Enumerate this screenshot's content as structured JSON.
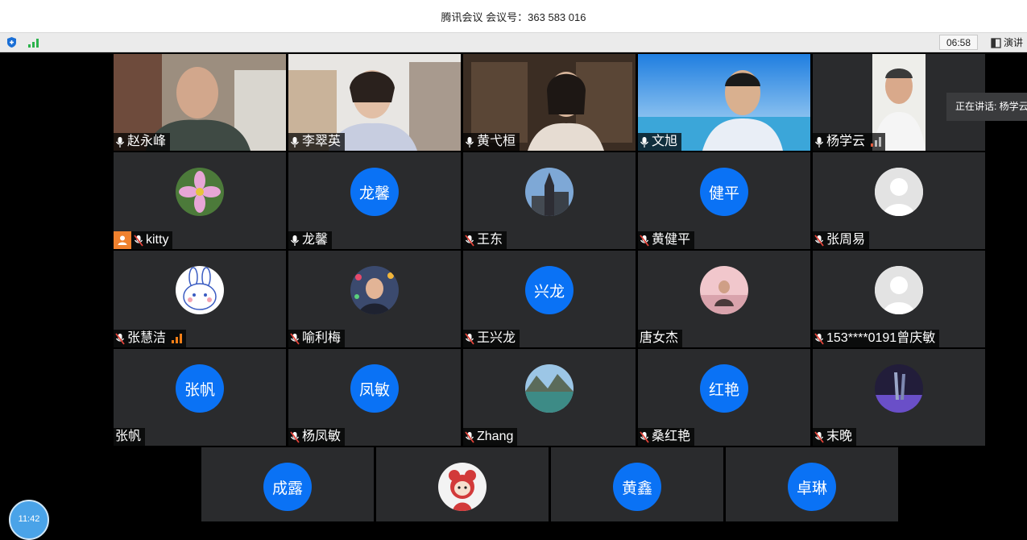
{
  "window": {
    "title": "腾讯会议 会议号：363 583 016"
  },
  "toolbar": {
    "timer": "06:58",
    "present_label": "演讲"
  },
  "speaking_tooltip": "正在讲话: 杨学云",
  "clock": {
    "time": "11:42"
  },
  "participants": [
    {
      "name": "赵永峰",
      "mic": "on",
      "video": true
    },
    {
      "name": "李翠英",
      "mic": "on",
      "video": true
    },
    {
      "name": "黄弋桓",
      "mic": "on",
      "video": true
    },
    {
      "name": "文旭",
      "mic": "on",
      "video": true
    },
    {
      "name": "杨学云",
      "mic": "on",
      "video": true,
      "speaking": true
    },
    {
      "name": "kitty",
      "mic": "muted",
      "avatar": "flower"
    },
    {
      "name": "龙馨",
      "mic": "on",
      "avatar_text": "龙馨"
    },
    {
      "name": "王东",
      "mic": "muted",
      "avatar": "church"
    },
    {
      "name": "黄健平",
      "mic": "muted",
      "avatar_text": "健平"
    },
    {
      "name": "张周易",
      "mic": "muted",
      "avatar": "default"
    },
    {
      "name": "张慧洁",
      "mic": "muted",
      "avatar": "rabbit"
    },
    {
      "name": "喻利梅",
      "mic": "muted",
      "avatar": "person"
    },
    {
      "name": "王兴龙",
      "mic": "muted",
      "avatar_text": "兴龙"
    },
    {
      "name": "唐女杰",
      "mic": "none",
      "avatar": "room"
    },
    {
      "name": "153****0191曾庆敏",
      "mic": "muted",
      "avatar": "default"
    },
    {
      "name": "张帆",
      "mic": "none",
      "avatar_text": "张帆"
    },
    {
      "name": "杨凤敏",
      "mic": "muted",
      "avatar_text": "凤敏"
    },
    {
      "name": "Zhang",
      "mic": "muted",
      "avatar": "lake"
    },
    {
      "name": "桑红艳",
      "mic": "muted",
      "avatar_text": "红艳"
    },
    {
      "name": "末晚",
      "mic": "muted",
      "avatar": "dark"
    },
    {
      "avatar_text": "成露"
    },
    {
      "avatar": "cartoon"
    },
    {
      "avatar_text": "黄鑫"
    },
    {
      "avatar_text": "卓琳"
    }
  ],
  "colors": {
    "accent_blue": "#0a72f5",
    "speaking_green": "#3fbf57",
    "tile_bg": "#2a2b2d"
  }
}
